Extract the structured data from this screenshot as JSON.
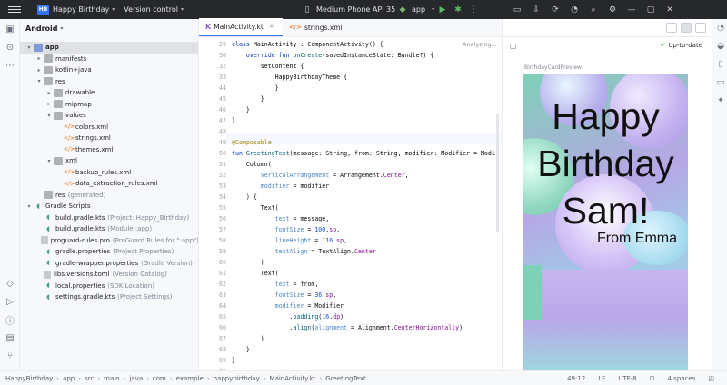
{
  "titlebar": {
    "project_badge": "HB",
    "project_name": "Happy Birthday",
    "vcs": "Version control",
    "device": "Medium Phone API 35",
    "run_config": "app"
  },
  "project_panel": {
    "view": "Android",
    "tree": [
      {
        "label": "app",
        "indent": 0,
        "arrow": "down",
        "icon": "folder-blue",
        "bold": true,
        "sel": true
      },
      {
        "label": "manifests",
        "indent": 1,
        "arrow": "right",
        "icon": "folder"
      },
      {
        "label": "kotlin+java",
        "indent": 1,
        "arrow": "right",
        "icon": "folder"
      },
      {
        "label": "res",
        "indent": 1,
        "arrow": "down",
        "icon": "folder"
      },
      {
        "label": "drawable",
        "indent": 2,
        "arrow": "right",
        "icon": "folder"
      },
      {
        "label": "mipmap",
        "indent": 2,
        "arrow": "right",
        "icon": "folder"
      },
      {
        "label": "values",
        "indent": 2,
        "arrow": "down",
        "icon": "folder"
      },
      {
        "label": "colors.xml",
        "indent": 3,
        "arrow": "",
        "icon": "xml"
      },
      {
        "label": "strings.xml",
        "indent": 3,
        "arrow": "",
        "icon": "xml"
      },
      {
        "label": "themes.xml",
        "indent": 3,
        "arrow": "",
        "icon": "xml"
      },
      {
        "label": "xml",
        "indent": 2,
        "arrow": "down",
        "icon": "folder"
      },
      {
        "label": "backup_rules.xml",
        "indent": 3,
        "arrow": "",
        "icon": "xml"
      },
      {
        "label": "data_extraction_rules.xml",
        "indent": 3,
        "arrow": "",
        "icon": "xml"
      },
      {
        "label": "res",
        "sub": "(generated)",
        "indent": 1,
        "arrow": "",
        "icon": "folder"
      },
      {
        "label": "Gradle Scripts",
        "indent": 0,
        "arrow": "down",
        "icon": "gradle"
      },
      {
        "label": "build.gradle.kts",
        "sub": "(Project: Happy_Birthday)",
        "indent": 1,
        "arrow": "",
        "icon": "gradle"
      },
      {
        "label": "build.gradle.kts",
        "sub": "(Module :app)",
        "indent": 1,
        "arrow": "",
        "icon": "gradle"
      },
      {
        "label": "proguard-rules.pro",
        "sub": "(ProGuard Rules for \":app\")",
        "indent": 1,
        "arrow": "",
        "icon": "file"
      },
      {
        "label": "gradle.properties",
        "sub": "(Project Properties)",
        "indent": 1,
        "arrow": "",
        "icon": "gradle"
      },
      {
        "label": "gradle-wrapper.properties",
        "sub": "(Gradle Version)",
        "indent": 1,
        "arrow": "",
        "icon": "gradle"
      },
      {
        "label": "libs.versions.toml",
        "sub": "(Version Catalog)",
        "indent": 1,
        "arrow": "",
        "icon": "file"
      },
      {
        "label": "local.properties",
        "sub": "(SDK Location)",
        "indent": 1,
        "arrow": "",
        "icon": "gradle"
      },
      {
        "label": "settings.gradle.kts",
        "sub": "(Project Settings)",
        "indent": 1,
        "arrow": "",
        "icon": "gradle"
      }
    ]
  },
  "tabs": [
    {
      "label": "MainActivity.kt",
      "active": true,
      "type": "kt"
    },
    {
      "label": "strings.xml",
      "active": false,
      "type": "xml"
    }
  ],
  "editor": {
    "status": "Analyzing...",
    "lines": [
      {
        "n": "29",
        "html": "<span class=\"kw\">class</span> MainActivity : ComponentActivity() {"
      },
      {
        "n": "30",
        "html": "    <span class=\"kw\">override fun</span> <span class=\"fn\">onCreate</span>(savedInstanceState: Bundle?) {"
      },
      {
        "n": "32",
        "html": "        setContent {"
      },
      {
        "n": "33",
        "html": "            HappyBirthdayTheme {"
      },
      {
        "n": "44",
        "html": "            }"
      },
      {
        "n": "45",
        "html": "        }"
      },
      {
        "n": "46",
        "html": "    }"
      },
      {
        "n": "47",
        "html": "}"
      },
      {
        "n": "48",
        "html": ""
      },
      {
        "n": "49",
        "html": "<span class=\"an\">@Composable</span>"
      },
      {
        "n": "50",
        "html": "<span class=\"kw\">fun</span> <span class=\"fn\">GreetingText</span>(message: String, from: String, modifier: Modifier = Modi"
      },
      {
        "n": "51",
        "html": "    Column("
      },
      {
        "n": "52",
        "html": "        <span class=\"named\">verticalArrangement</span> = Arrangement.<span class=\"param\">Center</span>,"
      },
      {
        "n": "53",
        "html": "        <span class=\"named\">modifier</span> = modifier"
      },
      {
        "n": "54",
        "html": "    ) {"
      },
      {
        "n": "55",
        "html": "        Text("
      },
      {
        "n": "56",
        "html": "            <span class=\"named\">text</span> = message,"
      },
      {
        "n": "57",
        "html": "            <span class=\"named\">fontSize</span> = <span class=\"num\">100</span>.<span class=\"param\">sp</span>,"
      },
      {
        "n": "58",
        "html": "            <span class=\"named\">lineHeight</span> = <span class=\"num\">116</span>.<span class=\"param\">sp</span>,"
      },
      {
        "n": "59",
        "html": "            <span class=\"named\">textAlign</span> = TextAlign.<span class=\"param\">Center</span>"
      },
      {
        "n": "60",
        "html": "        )"
      },
      {
        "n": "61",
        "html": "        Text("
      },
      {
        "n": "62",
        "html": "            <span class=\"named\">text</span> = from,"
      },
      {
        "n": "63",
        "html": "            <span class=\"named\">fontSize</span> = <span class=\"num\">36</span>.<span class=\"param\">sp</span>,"
      },
      {
        "n": "64",
        "html": "            <span class=\"named\">modifier</span> = Modifier"
      },
      {
        "n": "65",
        "html": "                .<span class=\"fn\">padding</span>(<span class=\"num\">16</span>.<span class=\"param\">dp</span>)"
      },
      {
        "n": "66",
        "html": "                .<span class=\"fn\">align</span>(<span class=\"named\">alignment</span> = Alignment.<span class=\"param\">CenterHorizontally</span>)"
      },
      {
        "n": "67",
        "html": "        )"
      },
      {
        "n": "68",
        "html": "    }"
      },
      {
        "n": "69",
        "html": "}"
      },
      {
        "n": "70",
        "html": ""
      },
      {
        "n": "71",
        "html": "<span class=\"an\">@Composable</span>"
      }
    ]
  },
  "preview": {
    "status": "Up-to-date",
    "name": "BirthdayCardPreview",
    "greeting": "Happy Birthday Sam!",
    "from": "From Emma"
  },
  "statusbar": {
    "crumbs": [
      "HappyBirthday",
      "app",
      "src",
      "main",
      "java",
      "com",
      "example",
      "happybirthday",
      "MainActivity.kt",
      "GreetingText"
    ],
    "position": "49:12",
    "line_sep": "LF",
    "encoding": "UTF-8",
    "indent": "4 spaces"
  }
}
